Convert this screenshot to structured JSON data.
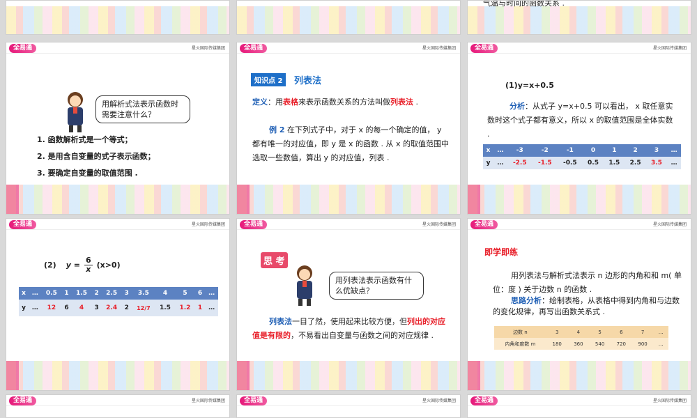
{
  "top_text": "气温与时间的函数关系 .",
  "header": {
    "logo": "全易通",
    "publisher": "星火国际传媒集团"
  },
  "s1": {
    "bubble": "用解析式法表示函数时需要注意什么？",
    "items": [
      "1. 函数解析式是一个等式；",
      "2. 是用含自变量的式子表示函数；",
      "3. 要确定自变量的取值范围 ."
    ]
  },
  "s2": {
    "badge": "知识点 2",
    "title": "列表法",
    "def_label": "定义",
    "def_a": "：用",
    "def_b": "表格",
    "def_c": "来表示函数关系的方法叫做",
    "def_d": "列表法",
    "def_e": " .",
    "ex_label": "例 2",
    "ex_text": "在下列式子中，对于 x 的每一个确定的值， y 都有唯一的对应值，即 y 是 x 的函数 . 从 x 的取值范围中选取一些数值，算出 y 的对应值，列表 ."
  },
  "s3": {
    "formula": "(1)y=x+0.5",
    "ana_label": "分析",
    "ana_text": "：从式子 y=x+0.5 可以看出， x 取任意实数时这个式子都有意义，所以 x 的取值范围是全体实数 .",
    "x": [
      "x",
      "…",
      "-3",
      "-2",
      "-1",
      "0",
      "1",
      "2",
      "3",
      "…"
    ],
    "y": [
      "y",
      "…",
      "-2.5",
      "-1.5",
      "",
      "-0.5",
      "0.5",
      "1.5",
      "2.5",
      "3.5",
      "…"
    ]
  },
  "s4": {
    "label": "(2)",
    "formula_y": "y =",
    "num": "6",
    "den": "x",
    "cond": "(x>0)",
    "x": [
      "x",
      "…",
      "0.5",
      "1",
      "1.5",
      "2",
      "2.5",
      "3",
      "3.5",
      "4",
      "5",
      "6",
      "…"
    ],
    "y": [
      "y",
      "…",
      "12",
      "6",
      "4",
      "3",
      "2.4",
      "2",
      "12/7",
      "1.5",
      "1.2",
      "1",
      "…"
    ]
  },
  "s5": {
    "badge": "思 考",
    "bubble": "用列表法表示函数有什么优缺点？",
    "p_a": "列表法",
    "p_b": "一目了然，使用起来比较方便，但",
    "p_c": "列出的对应值是有限的",
    "p_d": "，不易看出自变量与函数之间的对应规律 ."
  },
  "s6": {
    "title": "即学即练",
    "q": "用列表法与解析式法表示 n 边形的内角和和 m( 单位：度 ) 关于边数 n 的函数 .",
    "hint_label": "思路分析",
    "hint_text": "：绘制表格，从表格中得到内角和与边数的变化规律，再写出函数关系式 .",
    "row1": [
      "边数 n",
      "3",
      "4",
      "5",
      "6",
      "7",
      "…"
    ],
    "row2": [
      "内角和度数 m",
      "180",
      "360",
      "540",
      "720",
      "900",
      "…"
    ]
  }
}
